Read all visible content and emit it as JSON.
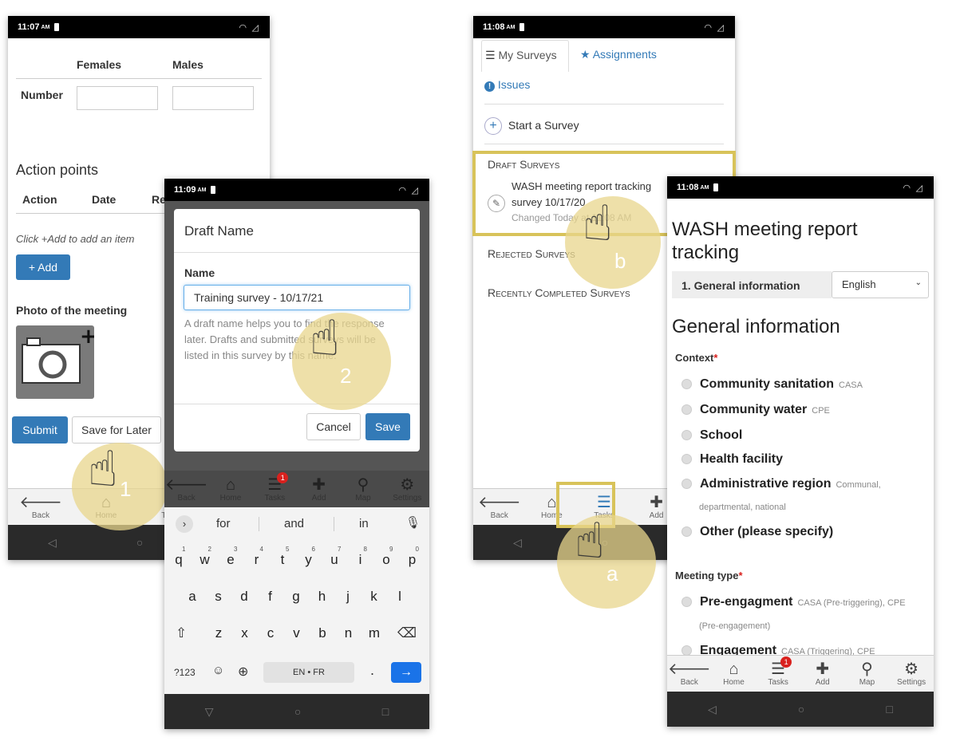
{
  "phone1": {
    "time": "11:07",
    "am": "AM",
    "col_females": "Females",
    "col_males": "Males",
    "row_number": "Number",
    "action_points_title": "Action points",
    "col_action": "Action",
    "col_date": "Date",
    "col_r": "Re",
    "add_hint": "Click +Add to add an item",
    "add_button": "+ Add",
    "photo_label": "Photo of the meeting",
    "submit": "Submit",
    "save_later": "Save for Later",
    "step": "1"
  },
  "phone2": {
    "time": "11:09",
    "am": "AM",
    "dialog_title": "Draft Name",
    "name_label": "Name",
    "name_value": "Training survey - 10/17/21",
    "help_text": "A draft name helps you to find the response later. Drafts and submitted surveys will be listed in this survey by this name.",
    "cancel": "Cancel",
    "save": "Save",
    "step": "2",
    "suggestions": [
      "for",
      "and",
      "in"
    ],
    "row1": [
      "q",
      "w",
      "e",
      "r",
      "t",
      "y",
      "u",
      "i",
      "o",
      "p"
    ],
    "row1_digits": [
      "1",
      "2",
      "3",
      "4",
      "5",
      "6",
      "7",
      "8",
      "9",
      "0"
    ],
    "row2": [
      "a",
      "s",
      "d",
      "f",
      "g",
      "h",
      "j",
      "k",
      "l"
    ],
    "row3": [
      "z",
      "x",
      "c",
      "v",
      "b",
      "n",
      "m"
    ],
    "sym_key": "?123",
    "space_key": "EN • FR"
  },
  "phone3": {
    "time": "11:08",
    "am": "AM",
    "tab_my_surveys": "My Surveys",
    "tab_assignments": "Assignments",
    "tab_issues": "Issues",
    "start_survey": "Start a Survey",
    "draft_heading": "Draft Surveys",
    "draft_title": "WASH meeting report tracking survey 10/17/20",
    "draft_changed": "Changed Today at 11:08 AM",
    "rejected_heading": "Rejected Surveys",
    "completed_heading": "Recently Completed Surveys",
    "step_a": "a",
    "step_b": "b"
  },
  "phone4": {
    "time": "11:08",
    "am": "AM",
    "title": "WASH meeting report tracking",
    "section_select": "1. General information",
    "language": "English",
    "section_heading": "General information",
    "context_label": "Context",
    "required_mark": "*",
    "options": [
      {
        "label": "Community sanitation",
        "tag": "CASA"
      },
      {
        "label": "Community water",
        "tag": "CPE"
      },
      {
        "label": "School",
        "tag": ""
      },
      {
        "label": "Health facility",
        "tag": ""
      },
      {
        "label": "Administrative region",
        "tag": "Communal,"
      },
      {
        "label": "Other (please specify)",
        "tag": ""
      }
    ],
    "admin_tag_line2": "departmental, national",
    "meeting_type_label": "Meeting type",
    "meeting_options": [
      {
        "label": "Pre-engagment",
        "tag": "CASA (Pre-triggering), CPE"
      },
      {
        "label": "Engagement",
        "tag": "CASA (Triggering), CPE"
      }
    ],
    "pre_tag_line2": "(Pre-engagement)"
  },
  "nav": {
    "back": "Back",
    "home": "Home",
    "tasks": "Tasks",
    "add": "Add",
    "map": "Map",
    "settings": "Settings",
    "tasks_badge": "1"
  }
}
